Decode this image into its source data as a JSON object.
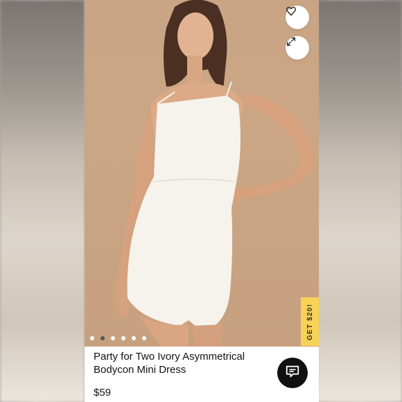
{
  "product": {
    "title": "Party for Two Ivory Asymmetrical Bodycon Mini Dress",
    "price": "$59"
  },
  "gallery": {
    "dot_count": 6,
    "active_index": 1
  },
  "promo": {
    "label": "GET $20!"
  },
  "icons": {
    "favorite": "heart-icon",
    "expand": "expand-icon",
    "chat": "chat-icon"
  },
  "colors": {
    "photo_background": "#c9a585",
    "promo_tab": "#f8d254",
    "chat_button": "#111111"
  }
}
